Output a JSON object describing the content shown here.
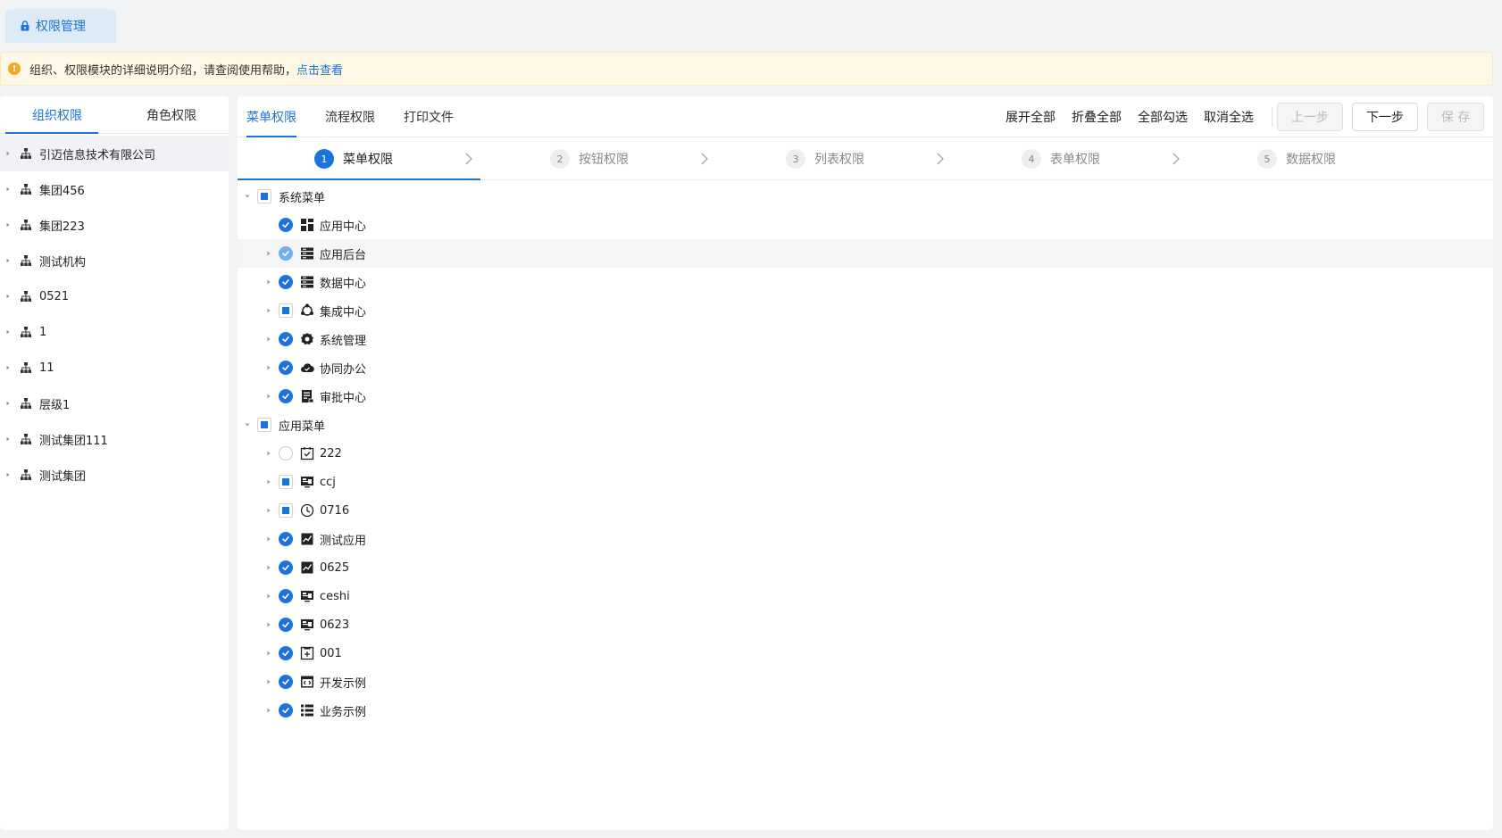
{
  "tabbar": {
    "active_tab": "权限管理"
  },
  "notice": {
    "text": "组织、权限模块的详细说明介绍，请查阅使用帮助，",
    "link": "点击查看"
  },
  "left": {
    "tabs": [
      "组织权限",
      "角色权限"
    ],
    "orgs": [
      "引迈信息技术有限公司",
      "集团456",
      "集团223",
      "测试机构",
      "0521",
      "1",
      "11",
      "层级1",
      "测试集团111",
      "测试集团"
    ]
  },
  "right": {
    "tabs": [
      "菜单权限",
      "流程权限",
      "打印文件"
    ],
    "actions": [
      "展开全部",
      "折叠全部",
      "全部勾选",
      "取消全选"
    ],
    "buttons": {
      "prev": "上一步",
      "next": "下一步",
      "save": "保 存"
    },
    "steps": [
      {
        "num": "1",
        "label": "菜单权限"
      },
      {
        "num": "2",
        "label": "按钮权限"
      },
      {
        "num": "3",
        "label": "列表权限"
      },
      {
        "num": "4",
        "label": "表单权限"
      },
      {
        "num": "5",
        "label": "数据权限"
      }
    ],
    "tree": {
      "system": {
        "label": "系统菜单",
        "children": [
          "应用中心",
          "应用后台",
          "数据中心",
          "集成中心",
          "系统管理",
          "协同办公",
          "审批中心"
        ]
      },
      "app": {
        "label": "应用菜单",
        "children": [
          "222",
          "ccj",
          "0716",
          "测试应用",
          "0625",
          "ceshi",
          "0623",
          "001",
          "开发示例",
          "业务示例"
        ]
      }
    }
  },
  "colors": {
    "accent": "#1a73d9",
    "notice_bg": "#fdf8e6",
    "warn": "#f5a623"
  }
}
